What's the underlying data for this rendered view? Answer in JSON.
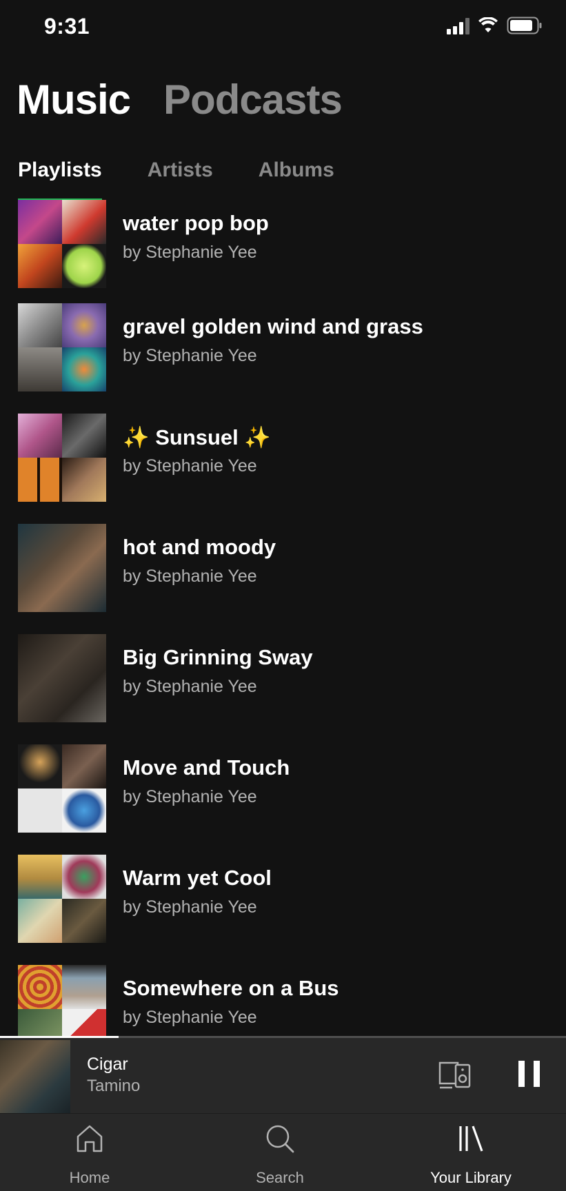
{
  "status_bar": {
    "time": "9:31"
  },
  "top_tabs": [
    {
      "label": "Music",
      "active": true
    },
    {
      "label": "Podcasts",
      "active": false
    }
  ],
  "sub_tabs": [
    {
      "label": "Playlists",
      "active": true
    },
    {
      "label": "Artists",
      "active": false
    },
    {
      "label": "Albums",
      "active": false
    }
  ],
  "playlists": [
    {
      "title": "water pop bop",
      "subtitle": "by Stephanie Yee"
    },
    {
      "title": "gravel golden wind and grass",
      "subtitle": "by Stephanie Yee"
    },
    {
      "title": "✨ Sunsuel ✨",
      "subtitle": "by Stephanie Yee"
    },
    {
      "title": "hot and moody",
      "subtitle": "by Stephanie Yee"
    },
    {
      "title": "Big Grinning Sway",
      "subtitle": "by Stephanie Yee"
    },
    {
      "title": "Move and Touch",
      "subtitle": "by Stephanie Yee"
    },
    {
      "title": "Warm yet Cool",
      "subtitle": "by Stephanie Yee"
    },
    {
      "title": "Somewhere on a Bus",
      "subtitle": "by Stephanie Yee"
    }
  ],
  "now_playing": {
    "title": "Cigar",
    "artist": "Tamino",
    "progress": 0.21
  },
  "bottom_nav": [
    {
      "label": "Home",
      "icon": "home-icon",
      "active": false
    },
    {
      "label": "Search",
      "icon": "search-icon",
      "active": false
    },
    {
      "label": "Your Library",
      "icon": "library-icon",
      "active": true
    }
  ],
  "colors": {
    "background": "#121212",
    "accent": "#1db954",
    "bar": "#282828",
    "muted": "#b3b3b3"
  }
}
